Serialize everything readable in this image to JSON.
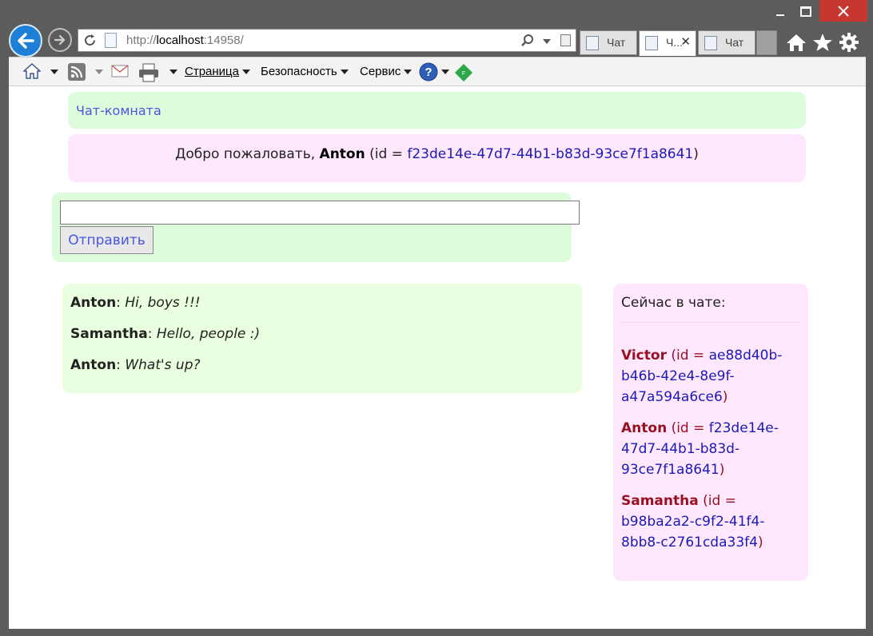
{
  "browser": {
    "address": {
      "scheme": "http://",
      "host": "localhost",
      "port": ":14958/"
    },
    "tabs": [
      {
        "label": "Чат ..."
      },
      {
        "label": "Ч..."
      },
      {
        "label": "Чат ..."
      }
    ],
    "command_bar": {
      "page_label": "Страница",
      "security_label": "Безопасность",
      "service_label": "Сервис"
    }
  },
  "page": {
    "header_title": "Чат-комната",
    "welcome": {
      "prefix": "Добро пожаловать, ",
      "name": "Anton",
      "id_prefix": " (id = ",
      "id": "f23de14e-47d7-44b1-b83d-93ce7f1a8641",
      "id_suffix": ")"
    },
    "send_button_label": "Отправить",
    "message_input_value": "",
    "messages": [
      {
        "author": "Anton",
        "sep": ": ",
        "text": "Hi, boys !!!"
      },
      {
        "author": "Samantha",
        "sep": ": ",
        "text": "Hello, people :)"
      },
      {
        "author": "Anton",
        "sep": ": ",
        "text": "What's up?"
      }
    ],
    "users_panel": {
      "title": "Сейчас в чате:",
      "users": [
        {
          "name": "Victor",
          "id_prefix": " (id = ",
          "id": "ae88d40b-b46b-42e4-8e9f-a47a594a6ce6",
          "id_suffix": ")"
        },
        {
          "name": "Anton",
          "id_prefix": " (id = ",
          "id": "f23de14e-47d7-44b1-b83d-93ce7f1a8641",
          "id_suffix": ")"
        },
        {
          "name": "Samantha",
          "id_prefix": " (id = ",
          "id": "b98ba2a2-c9f2-41f4-8bb8-c2761cda33f4",
          "id_suffix": ")"
        }
      ]
    }
  },
  "colors": {
    "header_bg": "#dcfcdc",
    "welcome_bg": "#ffe8fd",
    "chat_bg": "#eaffdf",
    "users_bg": "#ffe8fd",
    "link_blue": "#4a55e0",
    "id_blue": "#1a1ab8",
    "user_red": "#9a1020"
  },
  "icons": {
    "back": "back-arrow-icon",
    "forward": "forward-arrow-icon",
    "refresh": "refresh-icon",
    "search": "search-icon",
    "home": "home-icon",
    "favorites": "star-icon",
    "tools": "gear-icon",
    "rss": "rss-icon",
    "mail": "mail-icon",
    "print": "printer-icon",
    "help": "help-icon"
  }
}
